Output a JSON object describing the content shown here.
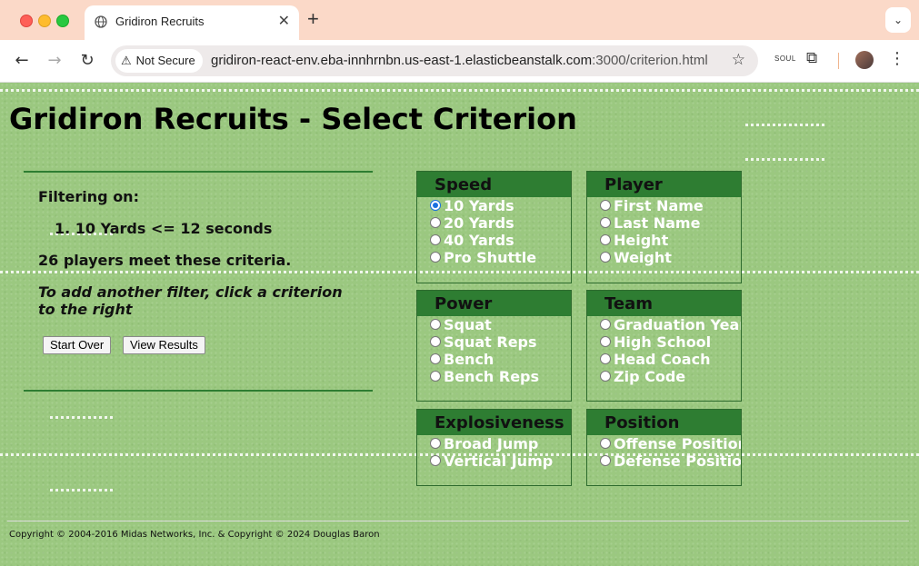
{
  "browser": {
    "tab_title": "Gridiron Recruits",
    "security_label": "Not Secure",
    "url_host": "gridiron-react-env.eba-innhrnbn.us-east-1.elasticbeanstalk.com",
    "url_rest": ":3000/criterion.html",
    "extension_label": "SOUL"
  },
  "page": {
    "title": "Gridiron Recruits - Select Criterion",
    "filter_label": "Filtering on:",
    "filters": [
      "1. 10 Yards <= 12 seconds"
    ],
    "count_text": "26 players meet these criteria.",
    "hint": "To add another filter, click a criterion to the right",
    "buttons": {
      "start_over": "Start Over",
      "view_results": "View Results"
    },
    "footer": "Copyright © 2004-2016 Midas Networks, Inc. & Copyright © 2024 Douglas Baron"
  },
  "criteria": {
    "speed": {
      "title": "Speed",
      "options": [
        "10 Yards",
        "20 Yards",
        "40 Yards",
        "Pro Shuttle"
      ],
      "selected": "10 Yards"
    },
    "player": {
      "title": "Player",
      "options": [
        "First Name",
        "Last Name",
        "Height",
        "Weight"
      ]
    },
    "power": {
      "title": "Power",
      "options": [
        "Squat",
        "Squat Reps",
        "Bench",
        "Bench Reps"
      ]
    },
    "team": {
      "title": "Team",
      "options": [
        "Graduation Year",
        "High School",
        "Head Coach",
        "Zip Code"
      ]
    },
    "explosiveness": {
      "title": "Explosiveness",
      "options": [
        "Broad Jump",
        "Vertical Jump"
      ]
    },
    "position": {
      "title": "Position",
      "options": [
        "Offense Position",
        "Defense Position"
      ]
    }
  },
  "colors": {
    "field": "#9bc880",
    "box_header": "#2e7d32",
    "tabbar": "#fbd9c8"
  }
}
